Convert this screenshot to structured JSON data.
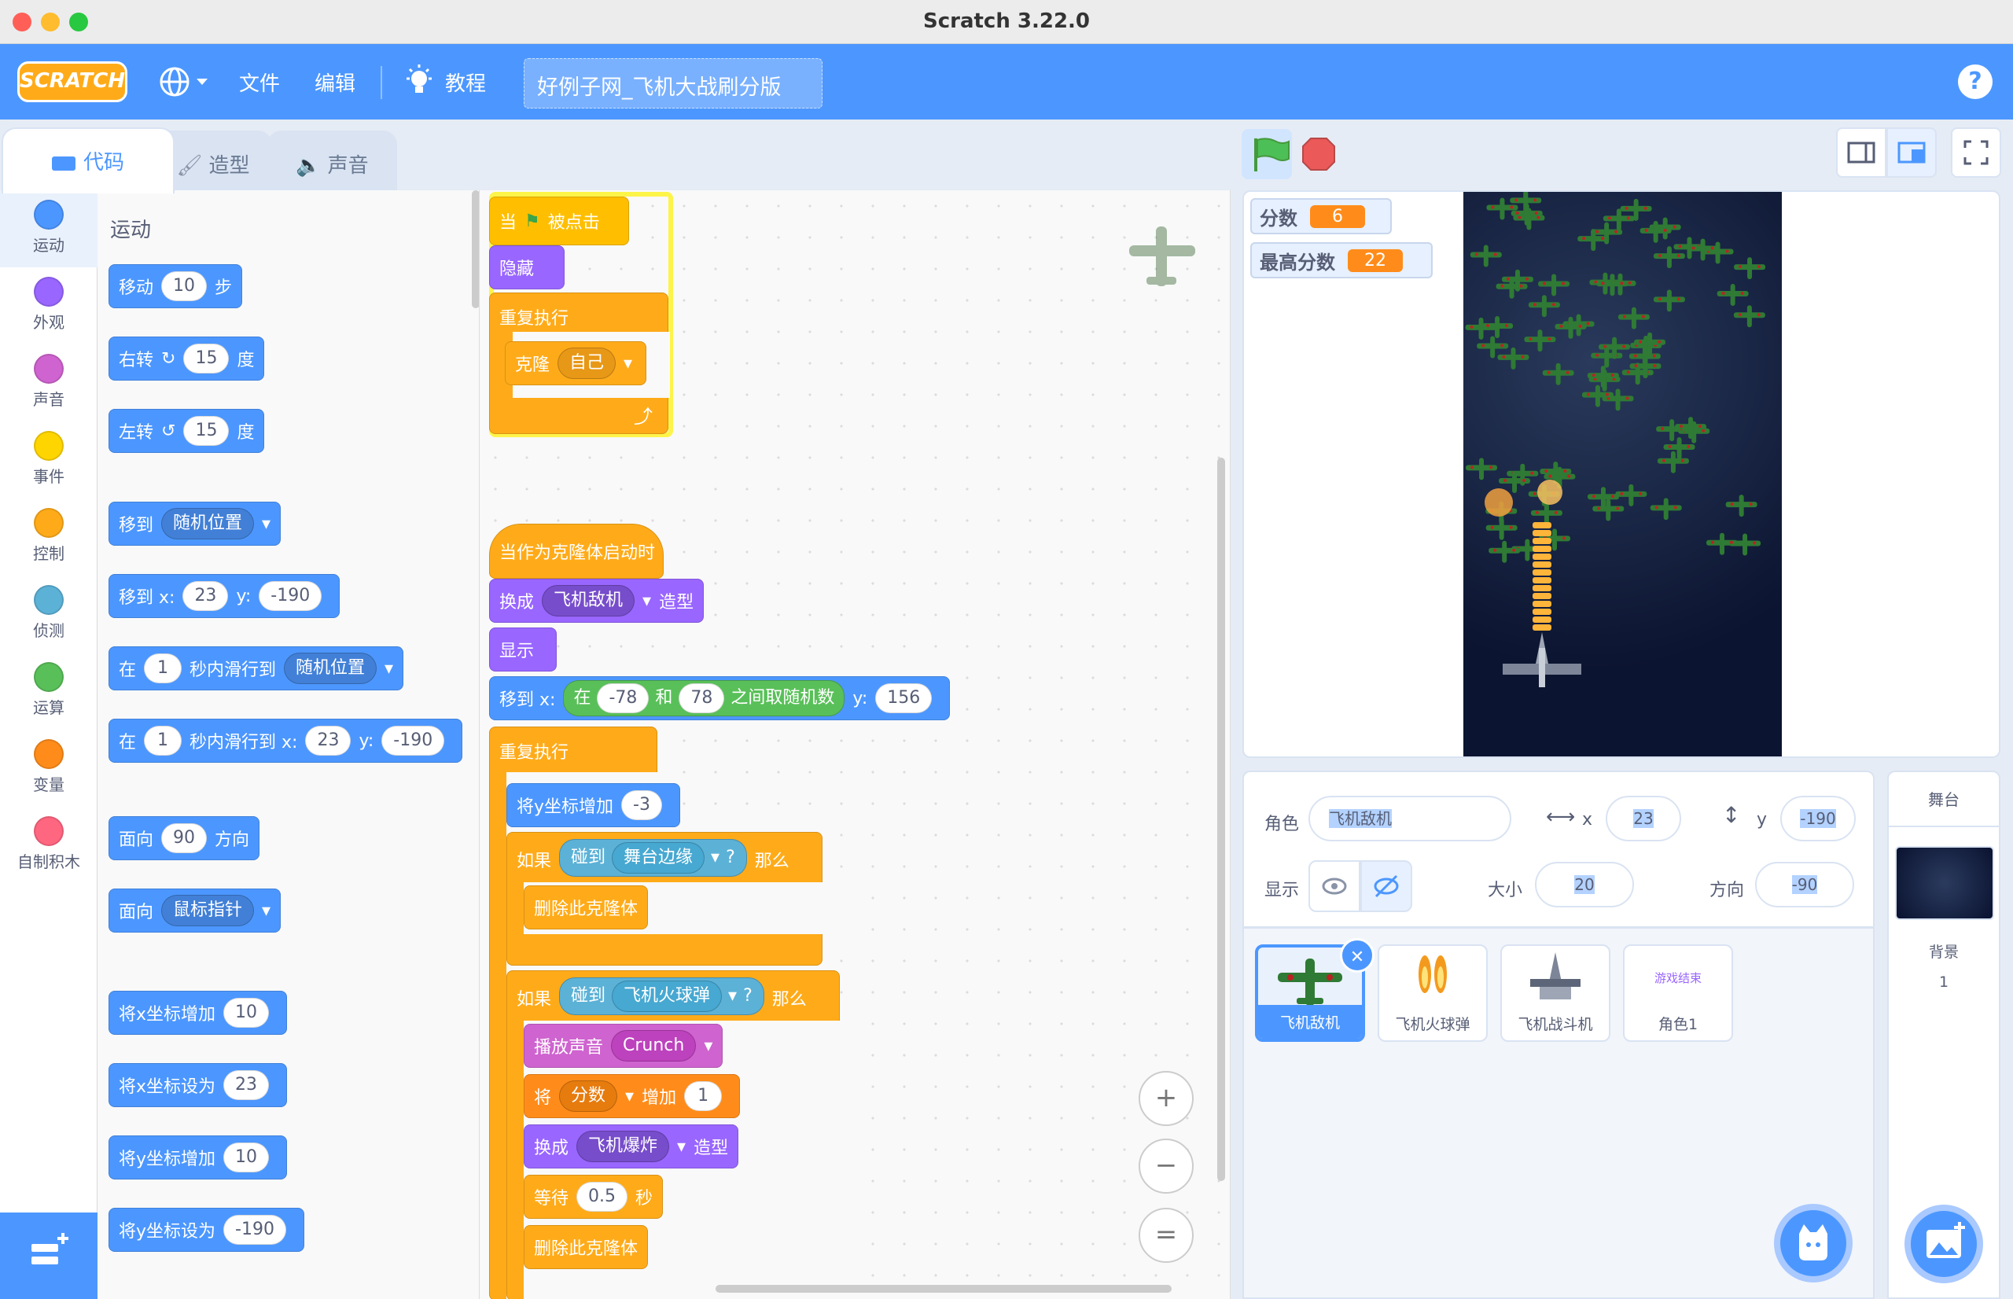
{
  "window": {
    "title": "Scratch 3.22.0"
  },
  "menubar": {
    "logo": "SCRATCH",
    "file": "文件",
    "edit": "编辑",
    "tutorials": "教程",
    "project_title": "好例子网_飞机大战刷分版",
    "help": "?"
  },
  "tabs": {
    "code": "代码",
    "costumes": "造型",
    "sounds": "声音"
  },
  "categories": [
    {
      "label": "运动",
      "color": "#4c97ff"
    },
    {
      "label": "外观",
      "color": "#9966ff"
    },
    {
      "label": "声音",
      "color": "#cf63cf"
    },
    {
      "label": "事件",
      "color": "#ffd500"
    },
    {
      "label": "控制",
      "color": "#ffab19"
    },
    {
      "label": "侦测",
      "color": "#5cb1d6"
    },
    {
      "label": "运算",
      "color": "#59c059"
    },
    {
      "label": "变量",
      "color": "#ff8c1a"
    },
    {
      "label": "自制积木",
      "color": "#ff6680"
    }
  ],
  "palette": {
    "heading": "运动",
    "move": {
      "a": "移动",
      "v": "10",
      "b": "步"
    },
    "turn_right": {
      "a": "右转",
      "v": "15",
      "b": "度"
    },
    "turn_left": {
      "a": "左转",
      "v": "15",
      "b": "度"
    },
    "goto": {
      "a": "移到",
      "d": "随机位置"
    },
    "goto_xy": {
      "a": "移到 x:",
      "x": "23",
      "yl": "y:",
      "y": "-190"
    },
    "glide": {
      "a": "在",
      "v": "1",
      "b": "秒内滑行到",
      "d": "随机位置"
    },
    "glide_xy": {
      "a": "在",
      "v": "1",
      "b": "秒内滑行到 x:",
      "x": "23",
      "yl": "y:",
      "y": "-190"
    },
    "point_dir": {
      "a": "面向",
      "v": "90",
      "b": "方向"
    },
    "point_to": {
      "a": "面向",
      "d": "鼠标指针"
    },
    "change_x": {
      "a": "将x坐标增加",
      "v": "10"
    },
    "set_x": {
      "a": "将x坐标设为",
      "v": "23"
    },
    "change_y": {
      "a": "将y坐标增加",
      "v": "10"
    },
    "set_y": {
      "a": "将y坐标设为",
      "v": "-190"
    }
  },
  "script1": {
    "hat_a": "当",
    "hat_b": "被点击",
    "hide": "隐藏",
    "forever": "重复执行",
    "clone": "克隆",
    "clone_d": "自己"
  },
  "script2": {
    "hat": "当作为克隆体启动时",
    "switch": "换成",
    "switch_d": "飞机敌机",
    "switch_b": "造型",
    "show": "显示",
    "goto": "移到 x:",
    "rand_a": "在",
    "rand_v1": "-78",
    "rand_and": "和",
    "rand_v2": "78",
    "rand_b": "之间取随机数",
    "goto_y": "y:",
    "goto_yv": "156",
    "forever": "重复执行",
    "change_y": "将y坐标增加",
    "change_y_v": "-3",
    "if1": "如果",
    "touch1": "碰到",
    "touch1_d": "舞台边缘",
    "q": "?",
    "then": "那么",
    "del1": "删除此克隆体",
    "if2": "如果",
    "touch2": "碰到",
    "touch2_d": "飞机火球弹",
    "sound": "播放声音",
    "sound_d": "Crunch",
    "chg": "将",
    "chg_d": "分数",
    "chg_b": "增加",
    "chg_v": "1",
    "switch2": "换成",
    "switch2_d": "飞机爆炸",
    "switch2_b": "造型",
    "wait": "等待",
    "wait_v": "0.5",
    "wait_b": "秒",
    "del2": "删除此克隆体"
  },
  "zoom": {
    "in": "+",
    "out": "−",
    "reset": "="
  },
  "monitors": [
    {
      "label": "分数",
      "value": "6"
    },
    {
      "label": "最高分数",
      "value": "22"
    }
  ],
  "sprite_info": {
    "sprite_label": "角色",
    "sprite_name": "飞机敌机",
    "x_label": "x",
    "x": "23",
    "y_label": "y",
    "y": "-190",
    "show_label": "显示",
    "size_label": "大小",
    "size": "20",
    "dir_label": "方向",
    "dir": "-90"
  },
  "sprites": [
    {
      "name": "飞机敌机"
    },
    {
      "name": "飞机火球弹"
    },
    {
      "name": "飞机战斗机"
    },
    {
      "name": "角色1",
      "thumb_text": "游戏结束"
    }
  ],
  "stage_pane": {
    "title": "舞台",
    "backdrop_label": "背景",
    "backdrop_count": "1"
  }
}
